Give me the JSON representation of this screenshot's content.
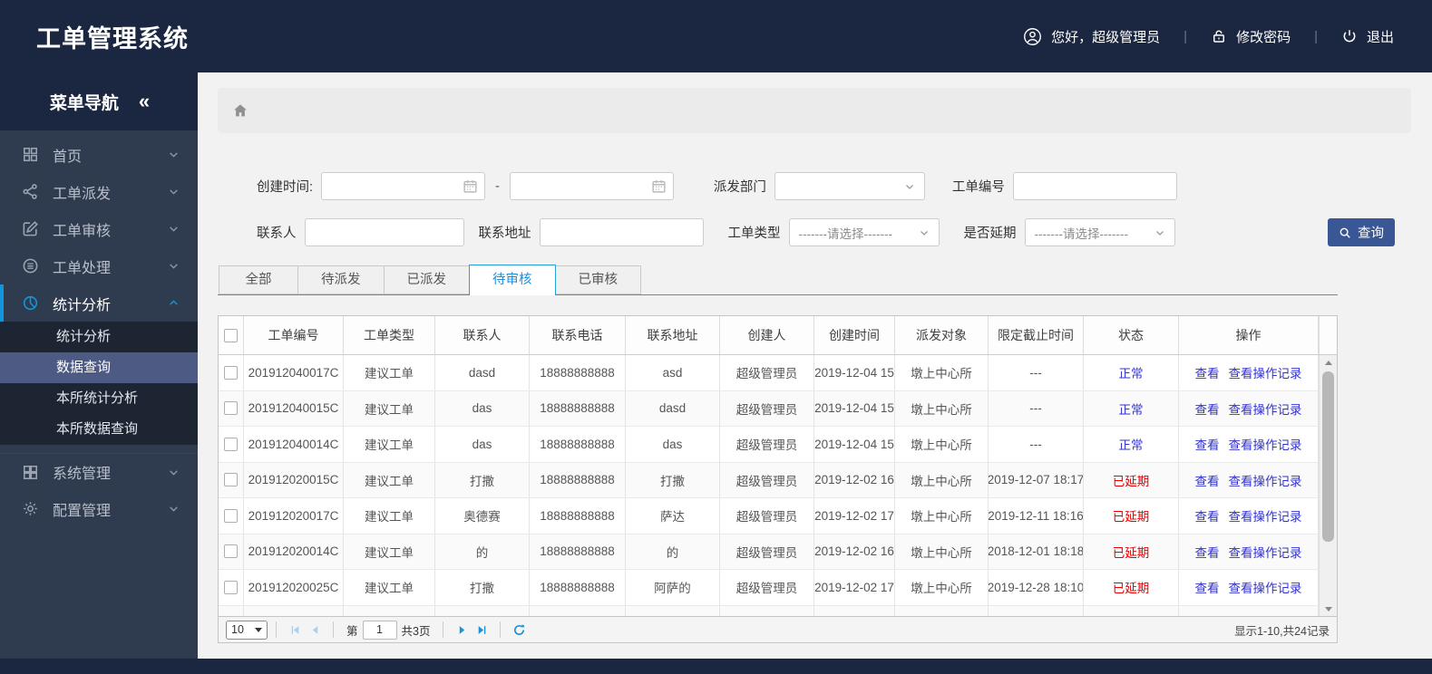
{
  "header": {
    "title": "工单管理系统",
    "greeting": "您好，超级管理员",
    "change_password": "修改密码",
    "logout": "退出",
    "separator": "|"
  },
  "sidebar": {
    "nav_title": "菜单导航",
    "collapse_glyph": "«",
    "items": [
      {
        "label": "首页",
        "icon": "home-grid-icon"
      },
      {
        "label": "工单派发",
        "icon": "share-icon"
      },
      {
        "label": "工单审核",
        "icon": "edit-icon"
      },
      {
        "label": "工单处理",
        "icon": "process-icon"
      },
      {
        "label": "统计分析",
        "icon": "pie-chart-icon",
        "active": true,
        "children": [
          "统计分析",
          "数据查询",
          "本所统计分析",
          "本所数据查询"
        ],
        "active_child": "数据查询"
      },
      {
        "label": "系统管理",
        "icon": "modules-icon"
      },
      {
        "label": "配置管理",
        "icon": "gear-icon"
      }
    ]
  },
  "search": {
    "create_time_label": "创建时间:",
    "range_separator": "-",
    "dispatch_dept_label": "派发部门",
    "order_no_label": "工单编号",
    "contact_label": "联系人",
    "address_label": "联系地址",
    "order_type_label": "工单类型",
    "delay_label": "是否延期",
    "select_placeholder": "-------请选择-------",
    "query_button": "查询"
  },
  "tabs": [
    {
      "label": "全部",
      "active": false
    },
    {
      "label": "待派发",
      "active": false
    },
    {
      "label": "已派发",
      "active": false
    },
    {
      "label": "待审核",
      "active": true
    },
    {
      "label": "已审核",
      "active": false
    }
  ],
  "table": {
    "columns": [
      "工单编号",
      "工单类型",
      "联系人",
      "联系电话",
      "联系地址",
      "创建人",
      "创建时间",
      "派发对象",
      "限定截止时间",
      "状态",
      "操作"
    ],
    "view_link": "查看",
    "view_log_link": "查看操作记录",
    "rows": [
      {
        "order_no": "201912040017C",
        "type": "建议工单",
        "contact": "dasd",
        "phone": "18888888888",
        "address": "asd",
        "creator": "超级管理员",
        "created": "2019-12-04 15",
        "target": "墩上中心所",
        "deadline": "---",
        "status": "正常",
        "delayed": false
      },
      {
        "order_no": "201912040015C",
        "type": "建议工单",
        "contact": "das",
        "phone": "18888888888",
        "address": "dasd",
        "creator": "超级管理员",
        "created": "2019-12-04 15",
        "target": "墩上中心所",
        "deadline": "---",
        "status": "正常",
        "delayed": false
      },
      {
        "order_no": "201912040014C",
        "type": "建议工单",
        "contact": "das",
        "phone": "18888888888",
        "address": "das",
        "creator": "超级管理员",
        "created": "2019-12-04 15",
        "target": "墩上中心所",
        "deadline": "---",
        "status": "正常",
        "delayed": false
      },
      {
        "order_no": "201912020015C",
        "type": "建议工单",
        "contact": "打撒",
        "phone": "18888888888",
        "address": "打撒",
        "creator": "超级管理员",
        "created": "2019-12-02 16",
        "target": "墩上中心所",
        "deadline": "2019-12-07 18:17",
        "status": "已延期",
        "delayed": true
      },
      {
        "order_no": "201912020017C",
        "type": "建议工单",
        "contact": "奥德赛",
        "phone": "18888888888",
        "address": "萨达",
        "creator": "超级管理员",
        "created": "2019-12-02 17",
        "target": "墩上中心所",
        "deadline": "2019-12-11 18:16",
        "status": "已延期",
        "delayed": true
      },
      {
        "order_no": "201912020014C",
        "type": "建议工单",
        "contact": "的",
        "phone": "18888888888",
        "address": "的",
        "creator": "超级管理员",
        "created": "2019-12-02 16",
        "target": "墩上中心所",
        "deadline": "2018-12-01 18:18",
        "status": "已延期",
        "delayed": true
      },
      {
        "order_no": "201912020025C",
        "type": "建议工单",
        "contact": "打撒",
        "phone": "18888888888",
        "address": "阿萨的",
        "creator": "超级管理员",
        "created": "2019-12-02 17",
        "target": "墩上中心所",
        "deadline": "2019-12-28 18:10",
        "status": "已延期",
        "delayed": true
      }
    ]
  },
  "pagination": {
    "page_size": "10",
    "page_prefix": "第",
    "current_page": "1",
    "total_pages": "共3页",
    "summary": "显示1-10,共24记录"
  },
  "colors": {
    "header_bg": "#1b2740",
    "sidebar_bg": "#2f3b4e",
    "active_submenu_bg": "#4d5b84",
    "accent_blue": "#1296db",
    "tab_active_blue": "#1f8dd6",
    "link_blue": "#3333cc",
    "status_normal": "#3333cc",
    "status_delayed": "#e60000",
    "query_button_bg": "#3a5795"
  }
}
